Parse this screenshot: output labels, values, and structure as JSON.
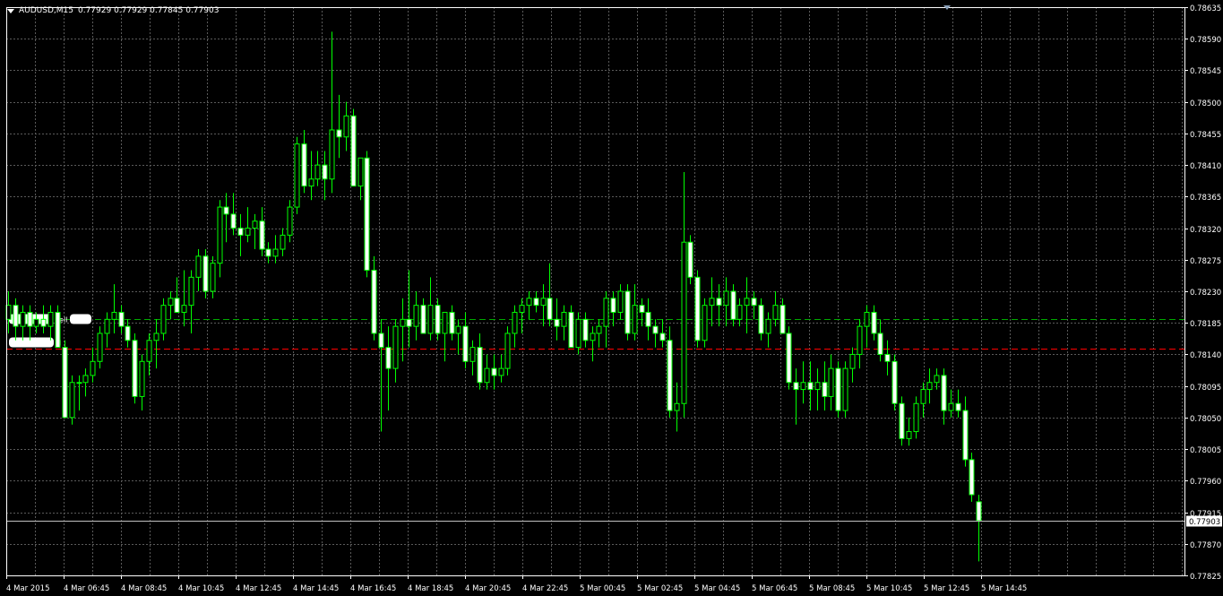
{
  "header": {
    "symbol": "AUDUSD,M15",
    "ohlc": "0.77929 0.77929 0.77845 0.77903"
  },
  "orders": {
    "sell_label": "sell",
    "sell_price": 0.7819,
    "sl_label": "sl",
    "sl_price": 0.78148
  },
  "current_price": {
    "label": "0.77903",
    "value": 0.77903
  },
  "colors": {
    "background": "#000000",
    "grid": "#5a5a5a",
    "axis": "#ffffff",
    "bull_candle": "#000000",
    "bear_candle": "#ffffff",
    "wick": "#00ff00",
    "sell_line": "#00aa00",
    "sl_line": "#ff0000",
    "price_line": "#c0c0c0"
  },
  "chart_data": {
    "type": "candlestick",
    "symbol": "AUDUSD",
    "timeframe": "M15",
    "grid": true,
    "ylim": [
      0.77825,
      0.78635
    ],
    "y_ticks": [
      "0.78635",
      "0.78590",
      "0.78545",
      "0.78500",
      "0.78455",
      "0.78410",
      "0.78365",
      "0.78320",
      "0.78275",
      "0.78230",
      "0.78185",
      "0.78140",
      "0.78095",
      "0.78050",
      "0.78005",
      "0.77960",
      "0.77915",
      "0.77870",
      "0.77825"
    ],
    "x_ticks": [
      "4 Mar 2015",
      "4 Mar 06:45",
      "4 Mar 08:45",
      "4 Mar 10:45",
      "4 Mar 12:45",
      "4 Mar 14:45",
      "4 Mar 16:45",
      "4 Mar 18:45",
      "4 Mar 20:45",
      "4 Mar 22:45",
      "5 Mar 00:45",
      "5 Mar 02:45",
      "5 Mar 04:45",
      "5 Mar 06:45",
      "5 Mar 08:45",
      "5 Mar 10:45",
      "5 Mar 12:45",
      "5 Mar 14:45"
    ],
    "candles": [
      {
        "o": 0.7819,
        "h": 0.7823,
        "l": 0.7817,
        "c": 0.7821
      },
      {
        "o": 0.7821,
        "h": 0.7822,
        "l": 0.7816,
        "c": 0.7818
      },
      {
        "o": 0.7818,
        "h": 0.7821,
        "l": 0.7816,
        "c": 0.782
      },
      {
        "o": 0.782,
        "h": 0.7821,
        "l": 0.7816,
        "c": 0.7818
      },
      {
        "o": 0.7818,
        "h": 0.782,
        "l": 0.7817,
        "c": 0.7819
      },
      {
        "o": 0.7819,
        "h": 0.7821,
        "l": 0.7817,
        "c": 0.7818
      },
      {
        "o": 0.7818,
        "h": 0.7821,
        "l": 0.7816,
        "c": 0.782
      },
      {
        "o": 0.782,
        "h": 0.7821,
        "l": 0.7815,
        "c": 0.7815
      },
      {
        "o": 0.7815,
        "h": 0.7816,
        "l": 0.7805,
        "c": 0.7805
      },
      {
        "o": 0.7805,
        "h": 0.7811,
        "l": 0.7804,
        "c": 0.781
      },
      {
        "o": 0.781,
        "h": 0.7811,
        "l": 0.7806,
        "c": 0.781
      },
      {
        "o": 0.781,
        "h": 0.7812,
        "l": 0.7808,
        "c": 0.7811
      },
      {
        "o": 0.7811,
        "h": 0.7815,
        "l": 0.781,
        "c": 0.7813
      },
      {
        "o": 0.7813,
        "h": 0.7818,
        "l": 0.7812,
        "c": 0.7817
      },
      {
        "o": 0.7817,
        "h": 0.782,
        "l": 0.7815,
        "c": 0.7819
      },
      {
        "o": 0.7819,
        "h": 0.7824,
        "l": 0.7817,
        "c": 0.782
      },
      {
        "o": 0.782,
        "h": 0.7821,
        "l": 0.7817,
        "c": 0.7818
      },
      {
        "o": 0.7818,
        "h": 0.7819,
        "l": 0.7815,
        "c": 0.7816
      },
      {
        "o": 0.7816,
        "h": 0.7817,
        "l": 0.7807,
        "c": 0.7808
      },
      {
        "o": 0.7808,
        "h": 0.7814,
        "l": 0.7806,
        "c": 0.7813
      },
      {
        "o": 0.7813,
        "h": 0.7817,
        "l": 0.7811,
        "c": 0.7816
      },
      {
        "o": 0.7816,
        "h": 0.7819,
        "l": 0.7812,
        "c": 0.7817
      },
      {
        "o": 0.7817,
        "h": 0.7822,
        "l": 0.7816,
        "c": 0.7821
      },
      {
        "o": 0.7821,
        "h": 0.7823,
        "l": 0.7819,
        "c": 0.7822
      },
      {
        "o": 0.7822,
        "h": 0.7825,
        "l": 0.782,
        "c": 0.782
      },
      {
        "o": 0.782,
        "h": 0.7826,
        "l": 0.7818,
        "c": 0.7821
      },
      {
        "o": 0.7821,
        "h": 0.7826,
        "l": 0.7817,
        "c": 0.7825
      },
      {
        "o": 0.7825,
        "h": 0.7829,
        "l": 0.7823,
        "c": 0.7828
      },
      {
        "o": 0.7828,
        "h": 0.7829,
        "l": 0.7822,
        "c": 0.7823
      },
      {
        "o": 0.7823,
        "h": 0.7828,
        "l": 0.7822,
        "c": 0.7827
      },
      {
        "o": 0.7827,
        "h": 0.7836,
        "l": 0.7825,
        "c": 0.7835
      },
      {
        "o": 0.7835,
        "h": 0.7837,
        "l": 0.783,
        "c": 0.7834
      },
      {
        "o": 0.7834,
        "h": 0.7837,
        "l": 0.7831,
        "c": 0.7832
      },
      {
        "o": 0.7832,
        "h": 0.7834,
        "l": 0.7828,
        "c": 0.7831
      },
      {
        "o": 0.7831,
        "h": 0.7835,
        "l": 0.783,
        "c": 0.7832
      },
      {
        "o": 0.7832,
        "h": 0.7834,
        "l": 0.7829,
        "c": 0.7833
      },
      {
        "o": 0.7833,
        "h": 0.7835,
        "l": 0.7828,
        "c": 0.7829
      },
      {
        "o": 0.7829,
        "h": 0.783,
        "l": 0.7827,
        "c": 0.7828
      },
      {
        "o": 0.7828,
        "h": 0.7831,
        "l": 0.7827,
        "c": 0.7829
      },
      {
        "o": 0.7829,
        "h": 0.7832,
        "l": 0.7828,
        "c": 0.7831
      },
      {
        "o": 0.7831,
        "h": 0.7836,
        "l": 0.783,
        "c": 0.7835
      },
      {
        "o": 0.7835,
        "h": 0.7845,
        "l": 0.7834,
        "c": 0.7844
      },
      {
        "o": 0.7844,
        "h": 0.7846,
        "l": 0.7837,
        "c": 0.7838
      },
      {
        "o": 0.7838,
        "h": 0.7843,
        "l": 0.7836,
        "c": 0.7839
      },
      {
        "o": 0.7839,
        "h": 0.7843,
        "l": 0.7838,
        "c": 0.7841
      },
      {
        "o": 0.7841,
        "h": 0.7843,
        "l": 0.7836,
        "c": 0.7839
      },
      {
        "o": 0.7839,
        "h": 0.786,
        "l": 0.7837,
        "c": 0.7846
      },
      {
        "o": 0.7846,
        "h": 0.7851,
        "l": 0.7842,
        "c": 0.7845
      },
      {
        "o": 0.7845,
        "h": 0.785,
        "l": 0.7843,
        "c": 0.7848
      },
      {
        "o": 0.7848,
        "h": 0.7849,
        "l": 0.7838,
        "c": 0.7838
      },
      {
        "o": 0.7838,
        "h": 0.7842,
        "l": 0.7836,
        "c": 0.7842
      },
      {
        "o": 0.7842,
        "h": 0.7843,
        "l": 0.7825,
        "c": 0.7826
      },
      {
        "o": 0.7826,
        "h": 0.7828,
        "l": 0.7816,
        "c": 0.7817
      },
      {
        "o": 0.7817,
        "h": 0.7819,
        "l": 0.7803,
        "c": 0.7815
      },
      {
        "o": 0.7815,
        "h": 0.7818,
        "l": 0.7806,
        "c": 0.7812
      },
      {
        "o": 0.7812,
        "h": 0.7819,
        "l": 0.781,
        "c": 0.7818
      },
      {
        "o": 0.7818,
        "h": 0.7822,
        "l": 0.7813,
        "c": 0.7819
      },
      {
        "o": 0.7819,
        "h": 0.7826,
        "l": 0.7815,
        "c": 0.7818
      },
      {
        "o": 0.7818,
        "h": 0.7823,
        "l": 0.7816,
        "c": 0.7821
      },
      {
        "o": 0.7821,
        "h": 0.7822,
        "l": 0.7817,
        "c": 0.7817
      },
      {
        "o": 0.7817,
        "h": 0.7825,
        "l": 0.7816,
        "c": 0.7821
      },
      {
        "o": 0.7821,
        "h": 0.7822,
        "l": 0.7816,
        "c": 0.7817
      },
      {
        "o": 0.7817,
        "h": 0.782,
        "l": 0.7813,
        "c": 0.782
      },
      {
        "o": 0.782,
        "h": 0.7821,
        "l": 0.7816,
        "c": 0.7817
      },
      {
        "o": 0.7817,
        "h": 0.7819,
        "l": 0.7814,
        "c": 0.7818
      },
      {
        "o": 0.7818,
        "h": 0.782,
        "l": 0.7812,
        "c": 0.7813
      },
      {
        "o": 0.7813,
        "h": 0.7816,
        "l": 0.7811,
        "c": 0.7815
      },
      {
        "o": 0.7815,
        "h": 0.7817,
        "l": 0.7809,
        "c": 0.781
      },
      {
        "o": 0.781,
        "h": 0.7814,
        "l": 0.7809,
        "c": 0.7812
      },
      {
        "o": 0.7812,
        "h": 0.7814,
        "l": 0.7809,
        "c": 0.7811
      },
      {
        "o": 0.7811,
        "h": 0.7814,
        "l": 0.781,
        "c": 0.7812
      },
      {
        "o": 0.7812,
        "h": 0.7818,
        "l": 0.7811,
        "c": 0.7817
      },
      {
        "o": 0.7817,
        "h": 0.7821,
        "l": 0.7815,
        "c": 0.782
      },
      {
        "o": 0.782,
        "h": 0.7822,
        "l": 0.7817,
        "c": 0.7821
      },
      {
        "o": 0.7821,
        "h": 0.7823,
        "l": 0.7819,
        "c": 0.7822
      },
      {
        "o": 0.7822,
        "h": 0.7823,
        "l": 0.782,
        "c": 0.7821
      },
      {
        "o": 0.7821,
        "h": 0.7824,
        "l": 0.7818,
        "c": 0.7822
      },
      {
        "o": 0.7822,
        "h": 0.7827,
        "l": 0.7818,
        "c": 0.7819
      },
      {
        "o": 0.7819,
        "h": 0.7822,
        "l": 0.7816,
        "c": 0.7818
      },
      {
        "o": 0.7818,
        "h": 0.7821,
        "l": 0.7816,
        "c": 0.782
      },
      {
        "o": 0.782,
        "h": 0.7821,
        "l": 0.7815,
        "c": 0.7815
      },
      {
        "o": 0.7815,
        "h": 0.782,
        "l": 0.7814,
        "c": 0.7819
      },
      {
        "o": 0.7819,
        "h": 0.782,
        "l": 0.7815,
        "c": 0.7816
      },
      {
        "o": 0.7816,
        "h": 0.7818,
        "l": 0.7813,
        "c": 0.7817
      },
      {
        "o": 0.7817,
        "h": 0.7819,
        "l": 0.7815,
        "c": 0.7818
      },
      {
        "o": 0.7818,
        "h": 0.7823,
        "l": 0.7815,
        "c": 0.7822
      },
      {
        "o": 0.7822,
        "h": 0.7823,
        "l": 0.7818,
        "c": 0.782
      },
      {
        "o": 0.782,
        "h": 0.7824,
        "l": 0.7819,
        "c": 0.7823
      },
      {
        "o": 0.7823,
        "h": 0.7824,
        "l": 0.7816,
        "c": 0.7817
      },
      {
        "o": 0.7817,
        "h": 0.7824,
        "l": 0.7816,
        "c": 0.7821
      },
      {
        "o": 0.7821,
        "h": 0.7822,
        "l": 0.7818,
        "c": 0.782
      },
      {
        "o": 0.782,
        "h": 0.7822,
        "l": 0.7816,
        "c": 0.7818
      },
      {
        "o": 0.7818,
        "h": 0.7819,
        "l": 0.7815,
        "c": 0.7817
      },
      {
        "o": 0.7817,
        "h": 0.7819,
        "l": 0.7815,
        "c": 0.7816
      },
      {
        "o": 0.7816,
        "h": 0.7818,
        "l": 0.7805,
        "c": 0.7806
      },
      {
        "o": 0.7806,
        "h": 0.781,
        "l": 0.7803,
        "c": 0.7807
      },
      {
        "o": 0.7807,
        "h": 0.784,
        "l": 0.7805,
        "c": 0.783
      },
      {
        "o": 0.783,
        "h": 0.7831,
        "l": 0.7824,
        "c": 0.7825
      },
      {
        "o": 0.7825,
        "h": 0.7826,
        "l": 0.7815,
        "c": 0.7816
      },
      {
        "o": 0.7816,
        "h": 0.7822,
        "l": 0.7815,
        "c": 0.7821
      },
      {
        "o": 0.7821,
        "h": 0.7825,
        "l": 0.7818,
        "c": 0.7822
      },
      {
        "o": 0.7822,
        "h": 0.7824,
        "l": 0.7818,
        "c": 0.7821
      },
      {
        "o": 0.7821,
        "h": 0.7825,
        "l": 0.7818,
        "c": 0.7823
      },
      {
        "o": 0.7823,
        "h": 0.7824,
        "l": 0.7818,
        "c": 0.7819
      },
      {
        "o": 0.7819,
        "h": 0.7822,
        "l": 0.7818,
        "c": 0.7821
      },
      {
        "o": 0.7821,
        "h": 0.7825,
        "l": 0.7817,
        "c": 0.7822
      },
      {
        "o": 0.7822,
        "h": 0.7823,
        "l": 0.7819,
        "c": 0.7821
      },
      {
        "o": 0.7821,
        "h": 0.7822,
        "l": 0.7816,
        "c": 0.7817
      },
      {
        "o": 0.7817,
        "h": 0.782,
        "l": 0.7815,
        "c": 0.7819
      },
      {
        "o": 0.7819,
        "h": 0.7823,
        "l": 0.7818,
        "c": 0.7821
      },
      {
        "o": 0.7821,
        "h": 0.7822,
        "l": 0.7817,
        "c": 0.7817
      },
      {
        "o": 0.7817,
        "h": 0.7818,
        "l": 0.7809,
        "c": 0.781
      },
      {
        "o": 0.781,
        "h": 0.7812,
        "l": 0.7804,
        "c": 0.7809
      },
      {
        "o": 0.7809,
        "h": 0.7813,
        "l": 0.7807,
        "c": 0.781
      },
      {
        "o": 0.781,
        "h": 0.7813,
        "l": 0.7806,
        "c": 0.7809
      },
      {
        "o": 0.7809,
        "h": 0.7812,
        "l": 0.7806,
        "c": 0.781
      },
      {
        "o": 0.781,
        "h": 0.7813,
        "l": 0.7806,
        "c": 0.7808
      },
      {
        "o": 0.7808,
        "h": 0.7814,
        "l": 0.7806,
        "c": 0.7812
      },
      {
        "o": 0.7812,
        "h": 0.7813,
        "l": 0.7805,
        "c": 0.7806
      },
      {
        "o": 0.7806,
        "h": 0.7813,
        "l": 0.7805,
        "c": 0.7812
      },
      {
        "o": 0.7812,
        "h": 0.7815,
        "l": 0.781,
        "c": 0.7814
      },
      {
        "o": 0.7814,
        "h": 0.7819,
        "l": 0.7812,
        "c": 0.7818
      },
      {
        "o": 0.7818,
        "h": 0.7821,
        "l": 0.7815,
        "c": 0.782
      },
      {
        "o": 0.782,
        "h": 0.7821,
        "l": 0.7816,
        "c": 0.7817
      },
      {
        "o": 0.7817,
        "h": 0.7819,
        "l": 0.7813,
        "c": 0.7814
      },
      {
        "o": 0.7814,
        "h": 0.7816,
        "l": 0.7811,
        "c": 0.7813
      },
      {
        "o": 0.7813,
        "h": 0.7814,
        "l": 0.7806,
        "c": 0.7807
      },
      {
        "o": 0.7807,
        "h": 0.7808,
        "l": 0.7801,
        "c": 0.7802
      },
      {
        "o": 0.7802,
        "h": 0.7805,
        "l": 0.7801,
        "c": 0.7803
      },
      {
        "o": 0.7803,
        "h": 0.7808,
        "l": 0.7802,
        "c": 0.7807
      },
      {
        "o": 0.7807,
        "h": 0.781,
        "l": 0.7805,
        "c": 0.7809
      },
      {
        "o": 0.7809,
        "h": 0.7812,
        "l": 0.7807,
        "c": 0.781
      },
      {
        "o": 0.781,
        "h": 0.7812,
        "l": 0.7809,
        "c": 0.7811
      },
      {
        "o": 0.7811,
        "h": 0.7812,
        "l": 0.7804,
        "c": 0.7806
      },
      {
        "o": 0.7806,
        "h": 0.7809,
        "l": 0.7805,
        "c": 0.7807
      },
      {
        "o": 0.7807,
        "h": 0.7809,
        "l": 0.7805,
        "c": 0.7806
      },
      {
        "o": 0.7806,
        "h": 0.7808,
        "l": 0.7798,
        "c": 0.7799
      },
      {
        "o": 0.7799,
        "h": 0.78,
        "l": 0.7793,
        "c": 0.7794
      },
      {
        "o": 0.7793,
        "h": 0.7794,
        "l": 0.77845,
        "c": 0.77903
      }
    ]
  }
}
